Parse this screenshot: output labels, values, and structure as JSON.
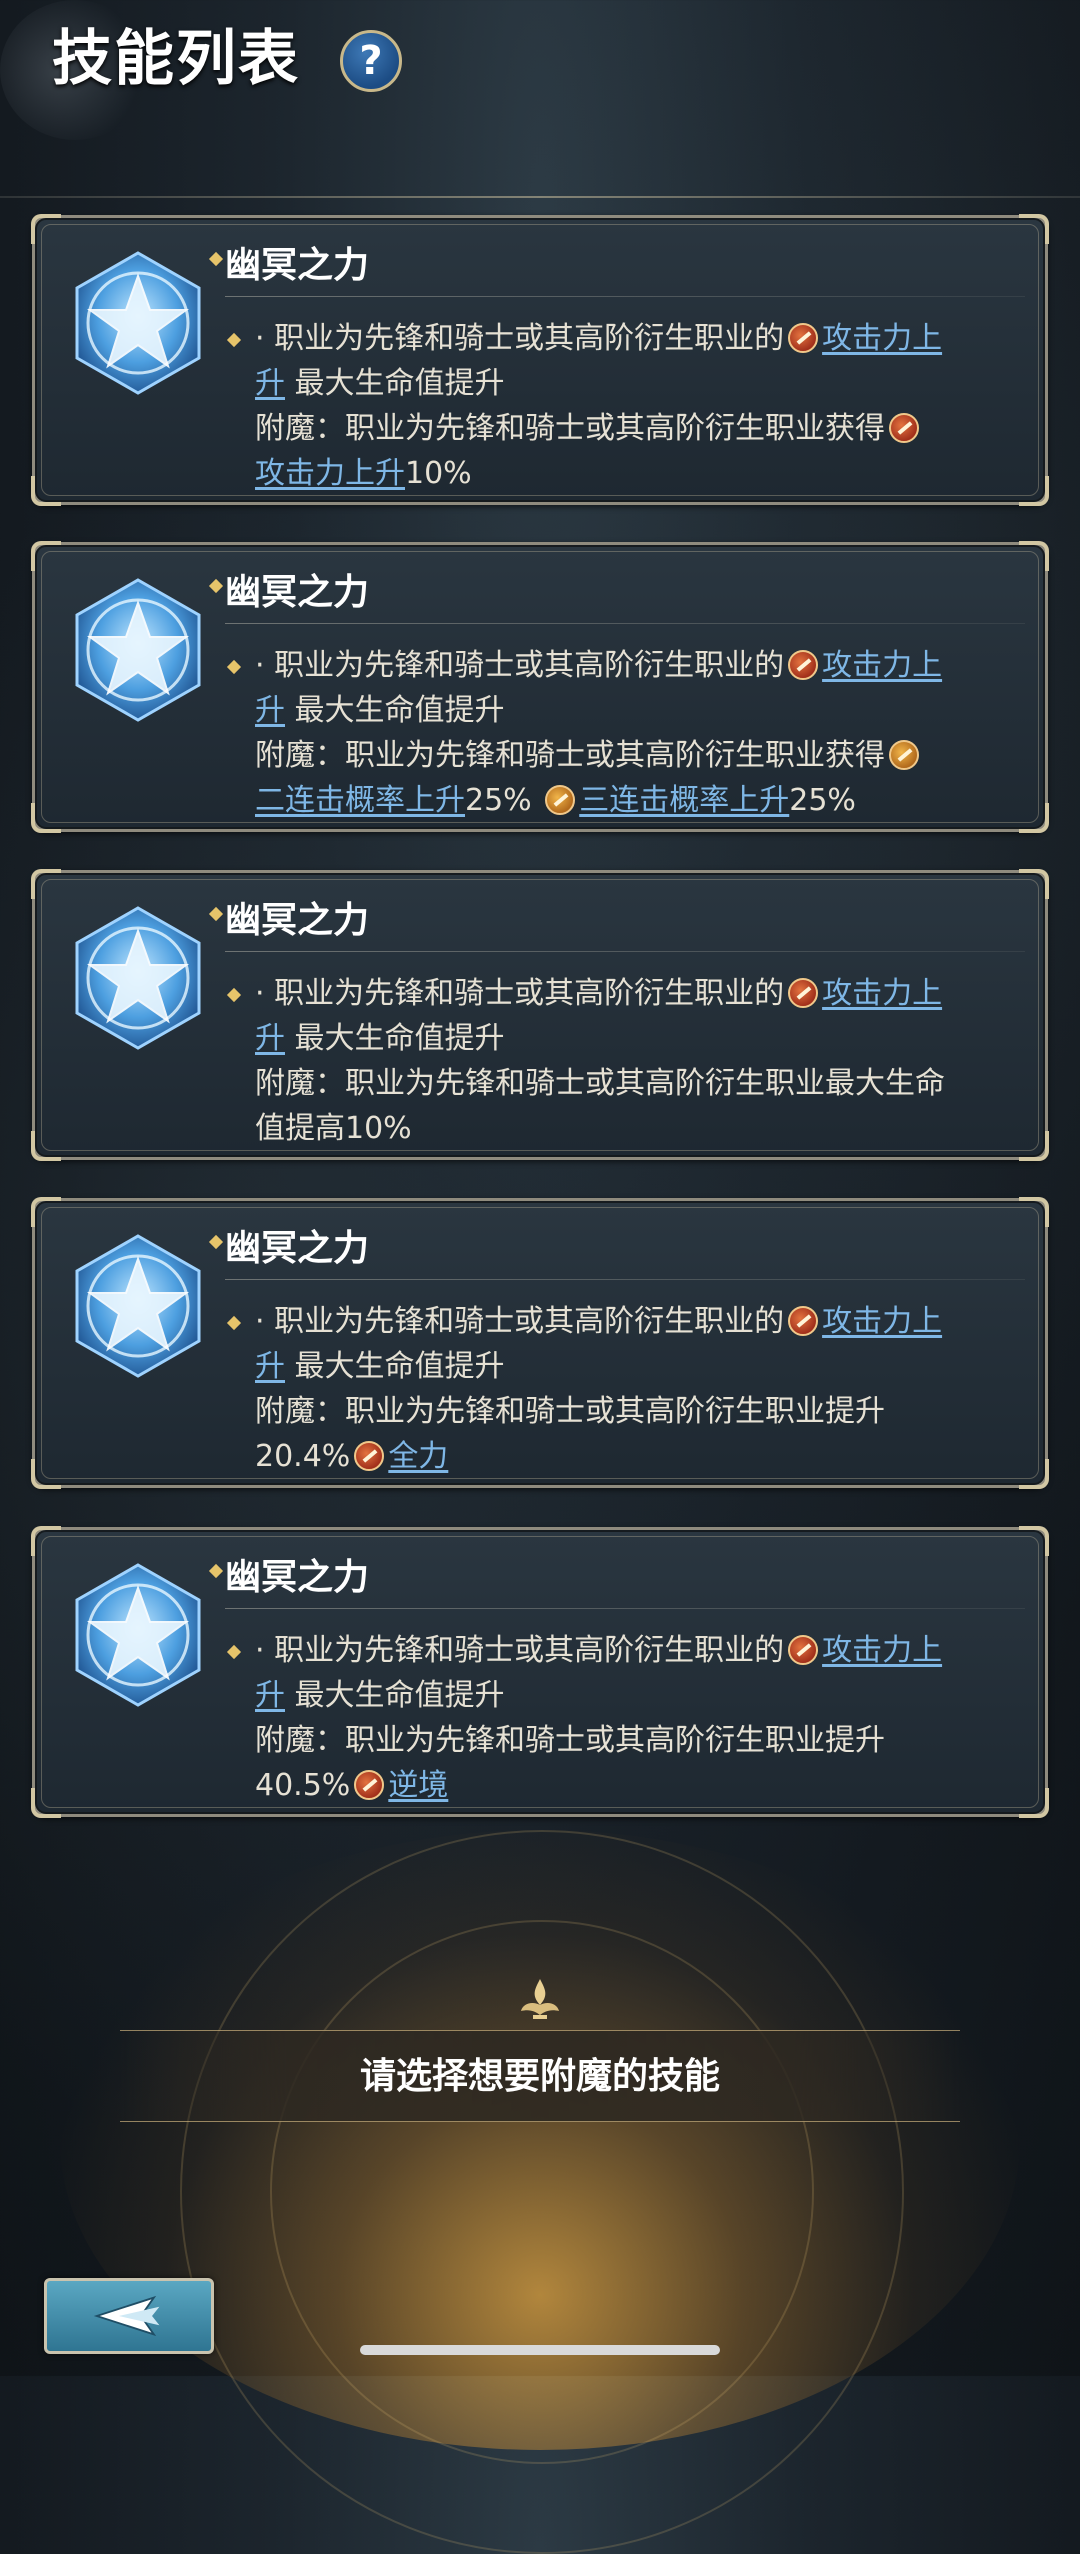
{
  "header": {
    "title": "技能列表",
    "help_label": "?"
  },
  "skills": [
    {
      "name": "幽冥之力",
      "line1_prefix": "· 职业为先锋和骑士或其高阶衍生职业的",
      "line1_link": "攻击力上",
      "line2_link": "升",
      "line2_rest": " 最大生命值提升",
      "enchant_line1": "附魔：职业为先锋和骑士或其高阶衍生职业获得",
      "enchant_line2_link": "攻击力上升",
      "enchant_line2_rest": "10%"
    },
    {
      "name": "幽冥之力",
      "line1_prefix": "· 职业为先锋和骑士或其高阶衍生职业的",
      "line1_link": "攻击力上",
      "line2_link": "升",
      "line2_rest": " 最大生命值提升",
      "enchant_line1": "附魔：职业为先锋和骑士或其高阶衍生职业获得",
      "enchant_line2_link_a": "二连击概率上升",
      "enchant_line2_val_a": "25%",
      "enchant_line2_link_b": "三连击概率上升",
      "enchant_line2_val_b": "25%"
    },
    {
      "name": "幽冥之力",
      "line1_prefix": "· 职业为先锋和骑士或其高阶衍生职业的",
      "line1_link": "攻击力上",
      "line2_link": "升",
      "line2_rest": " 最大生命值提升",
      "enchant_line1": "附魔：职业为先锋和骑士或其高阶衍生职业最大生命",
      "enchant_line2": "值提高10%"
    },
    {
      "name": "幽冥之力",
      "line1_prefix": "· 职业为先锋和骑士或其高阶衍生职业的",
      "line1_link": "攻击力上",
      "line2_link": "升",
      "line2_rest": " 最大生命值提升",
      "enchant_line1": "附魔：职业为先锋和骑士或其高阶衍生职业提升",
      "enchant_line2_val": "20.4%",
      "enchant_line2_link": "全力"
    },
    {
      "name": "幽冥之力",
      "line1_prefix": "· 职业为先锋和骑士或其高阶衍生职业的",
      "line1_link": "攻击力上",
      "line2_link": "升",
      "line2_rest": " 最大生命值提升",
      "enchant_line1": "附魔：职业为先锋和骑士或其高阶衍生职业提升",
      "enchant_line2_val": "40.5%",
      "enchant_line2_link": "逆境"
    }
  ],
  "prompt": {
    "text": "请选择想要附魔的技能"
  },
  "colors": {
    "link": "#7fb7e6",
    "accent_gold": "#e6c46a",
    "card_border": "#8f8b7e"
  },
  "icons": {
    "skill": "star-crest-icon",
    "buff_attack": "sword-buff-icon",
    "buff_combo": "double-sword-buff-icon",
    "back": "back-arrow-icon"
  }
}
